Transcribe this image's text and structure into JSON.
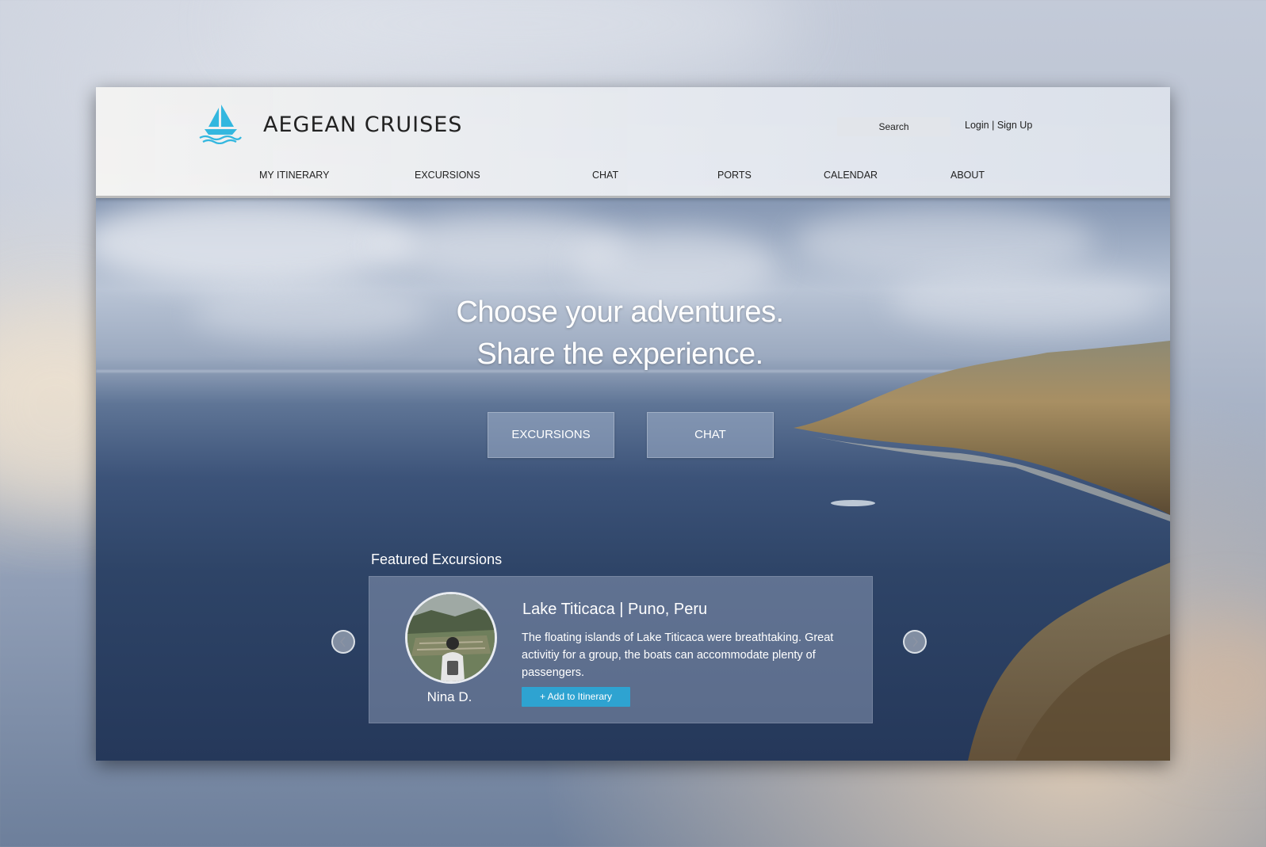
{
  "header": {
    "brand": "AEGEAN CRUISES",
    "search_placeholder": "Search",
    "login": "Login",
    "auth_separator": "|",
    "signup": "Sign Up"
  },
  "nav": [
    {
      "label": "MY ITINERARY"
    },
    {
      "label": "EXCURSIONS"
    },
    {
      "label": "CHAT"
    },
    {
      "label": "PORTS"
    },
    {
      "label": "CALENDAR"
    },
    {
      "label": "ABOUT"
    }
  ],
  "hero": {
    "line1": "Choose your adventures.",
    "line2": "Share the experience.",
    "cta_excursions": "EXCURSIONS",
    "cta_chat": "CHAT"
  },
  "featured": {
    "heading": "Featured Excursions",
    "card": {
      "title": "Lake Titicaca | Puno, Peru",
      "description": "The floating islands of Lake Titicaca were breathtaking. Great activitiy for a group, the boats can accommodate plenty of passengers.",
      "author": "Nina D.",
      "add_button": "+ Add to Itinerary"
    }
  },
  "colors": {
    "accent": "#2ea3d1",
    "logo": "#33b7df"
  },
  "icons": {
    "logo": "sailboat-icon",
    "prev": "chevron-left-icon",
    "next": "chevron-right-icon"
  }
}
